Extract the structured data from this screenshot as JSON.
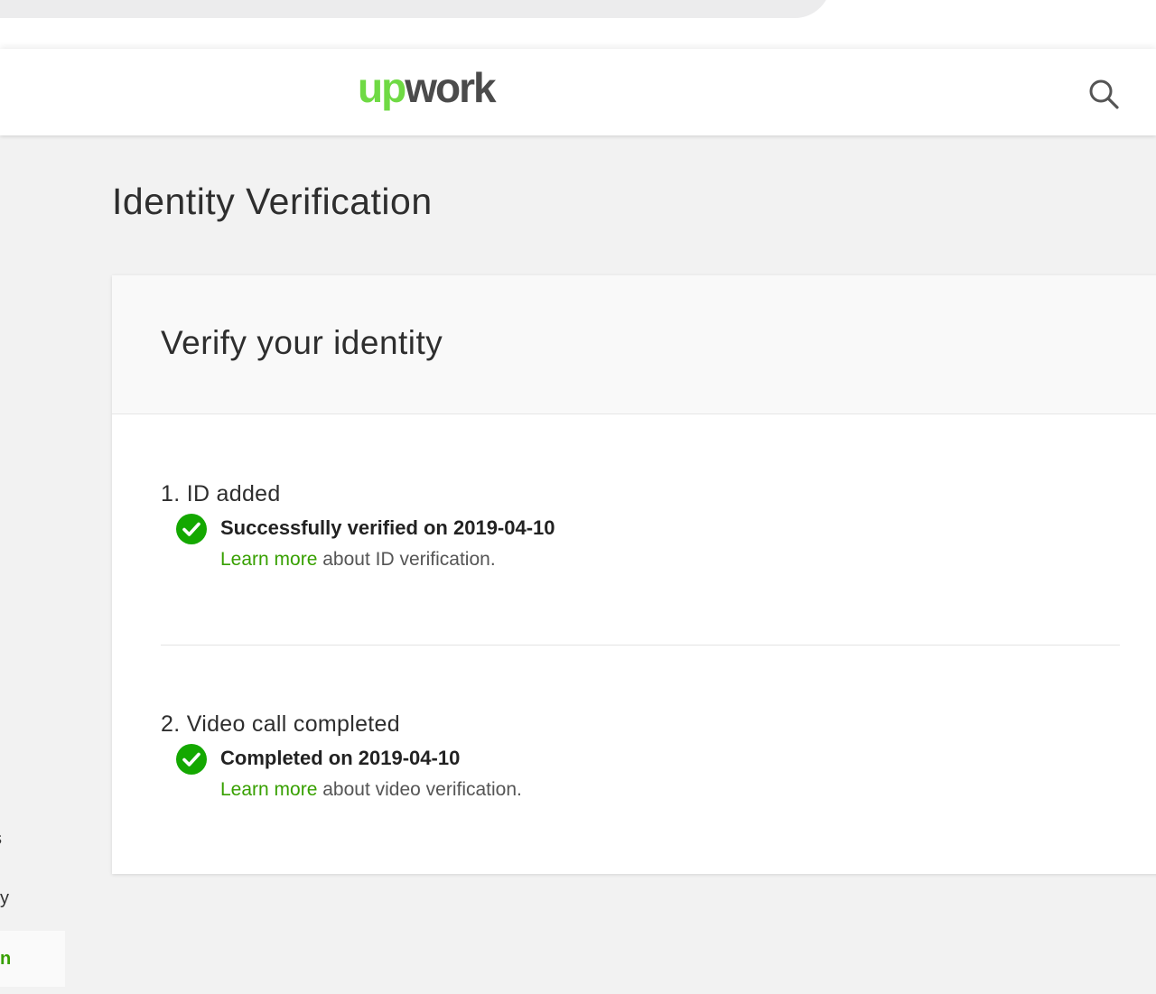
{
  "header": {
    "logo_up": "up",
    "logo_work": "work",
    "search_icon": "search-icon"
  },
  "sidebar": {
    "items": [
      {
        "label": "s"
      },
      {
        "label": "y"
      },
      {
        "label": "n",
        "active": true
      }
    ]
  },
  "page": {
    "title": "Identity Verification"
  },
  "card": {
    "title": "Verify your identity",
    "steps": [
      {
        "title": "1. ID added",
        "status": "Successfully verified on 2019-04-10",
        "link": "Learn more",
        "link_suffix": " about ID verification.",
        "icon": "check-circle-icon"
      },
      {
        "title": "2. Video call completed",
        "status": "Completed on 2019-04-10",
        "link": "Learn more",
        "link_suffix": " about video verification.",
        "icon": "check-circle-icon"
      }
    ]
  },
  "colors": {
    "brand_green": "#6fda44",
    "link_green": "#37a000",
    "check_green": "#14a800"
  }
}
